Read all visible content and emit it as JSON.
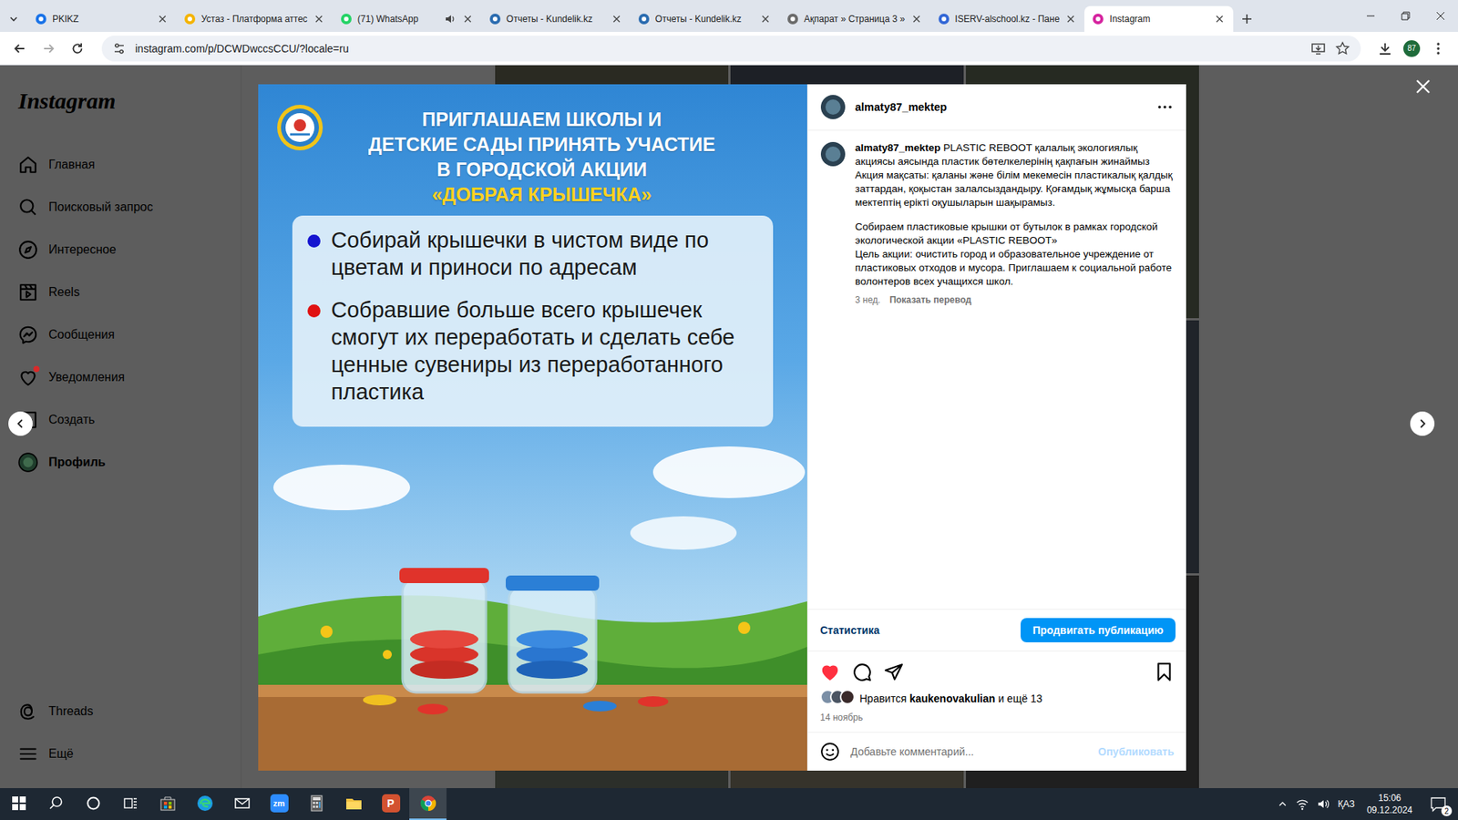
{
  "browser": {
    "tabs": [
      {
        "label": "PKIKZ",
        "selected": false,
        "audio": false
      },
      {
        "label": "Устаз - Платформа аттес",
        "selected": false,
        "audio": false
      },
      {
        "label": "(71) WhatsApp",
        "selected": false,
        "audio": true
      },
      {
        "label": "Отчеты - Kundelik.kz",
        "selected": false,
        "audio": false
      },
      {
        "label": "Отчеты - Kundelik.kz",
        "selected": false,
        "audio": false
      },
      {
        "label": "Ақпарат » Страница 3 »",
        "selected": false,
        "audio": false
      },
      {
        "label": "ISERV-alschool.kz - Пане",
        "selected": false,
        "audio": false
      },
      {
        "label": "Instagram",
        "selected": true,
        "audio": false
      }
    ],
    "address": "instagram.com/p/DCWDwccsCCU/?locale=ru",
    "profile_badge": "87"
  },
  "instagram": {
    "logo": "Instagram",
    "nav": [
      {
        "label": "Главная",
        "selected": false,
        "badge": false
      },
      {
        "label": "Поисковый запрос",
        "selected": false,
        "badge": false
      },
      {
        "label": "Интересное",
        "selected": false,
        "badge": false
      },
      {
        "label": "Reels",
        "selected": false,
        "badge": false
      },
      {
        "label": "Сообщения",
        "selected": false,
        "badge": false
      },
      {
        "label": "Уведомления",
        "selected": false,
        "badge": true
      },
      {
        "label": "Создать",
        "selected": false,
        "badge": false
      },
      {
        "label": "Профиль",
        "selected": true,
        "badge": false
      }
    ],
    "nav_bottom": [
      {
        "label": "Threads"
      },
      {
        "label": "Ещё"
      }
    ],
    "post": {
      "poster": {
        "headline": [
          "ПРИГЛАШАЕМ ШКОЛЫ И",
          "ДЕТСКИЕ САДЫ ПРИНЯТЬ УЧАСТИЕ",
          "В ГОРОДСКОЙ АКЦИИ"
        ],
        "highlight": "«ДОБРАЯ КРЫШЕЧКА»",
        "bullets": [
          {
            "text": "Собирай крышечки в чистом виде по цветам и приноси по адресам",
            "color": "#1515d0"
          },
          {
            "text": "Собравшие больше всего крышечек смогут их переработать и сделать себе ценные сувениры из переработанного пластика",
            "color": "#e01212"
          }
        ]
      },
      "author": "almaty87_mektep",
      "caption": [
        [
          "PLASTIC REBOOT қалалық экологиялық акциясы аясында пластик бөтелкелерінің қақпағын жинаймыз",
          "Акция мақсаты: қаланы және білім мекемесін пластикалық қалдық заттардан, қоқыстан залалсыздандыру. Қоғамдық жұмысқа барша мектептің ерікті оқушыларын шақырамыз."
        ],
        [
          "Собираем пластиковые крышки от бутылок в рамках городской экологической акции «PLASTIC REBOOT»",
          "Цель акции: очистить город и образовательное учреждение от пластиковых отходов и мусора. Приглашаем к социальной работе волонтеров всех учащихся школ."
        ]
      ],
      "age": "3 нед.",
      "translate": "Показать перевод",
      "stats_link": "Статистика",
      "promote": "Продвигать публикацию",
      "liked": true,
      "saved": false,
      "likes": {
        "prefix": "Нравится",
        "user": "kaukenovakulian",
        "suffix": "и ещё 13"
      },
      "date": "14 ноябрь",
      "comment_placeholder": "Добавьте комментарий...",
      "publish": {
        "label": "Опубликовать",
        "disabled": true
      }
    }
  },
  "taskbar": {
    "apps": [
      {
        "kind": "store",
        "selected": false
      },
      {
        "kind": "edge",
        "selected": false
      },
      {
        "kind": "mail",
        "selected": false
      },
      {
        "kind": "zoom",
        "label": "zm",
        "selected": false
      },
      {
        "kind": "calculator",
        "selected": false
      },
      {
        "kind": "explorer",
        "selected": false
      },
      {
        "kind": "powerpoint",
        "label": "P",
        "selected": false
      },
      {
        "kind": "chrome",
        "selected": true
      }
    ],
    "language": "ҚАЗ",
    "time": "15:06",
    "date": "09.12.2024",
    "notifications": "2"
  }
}
